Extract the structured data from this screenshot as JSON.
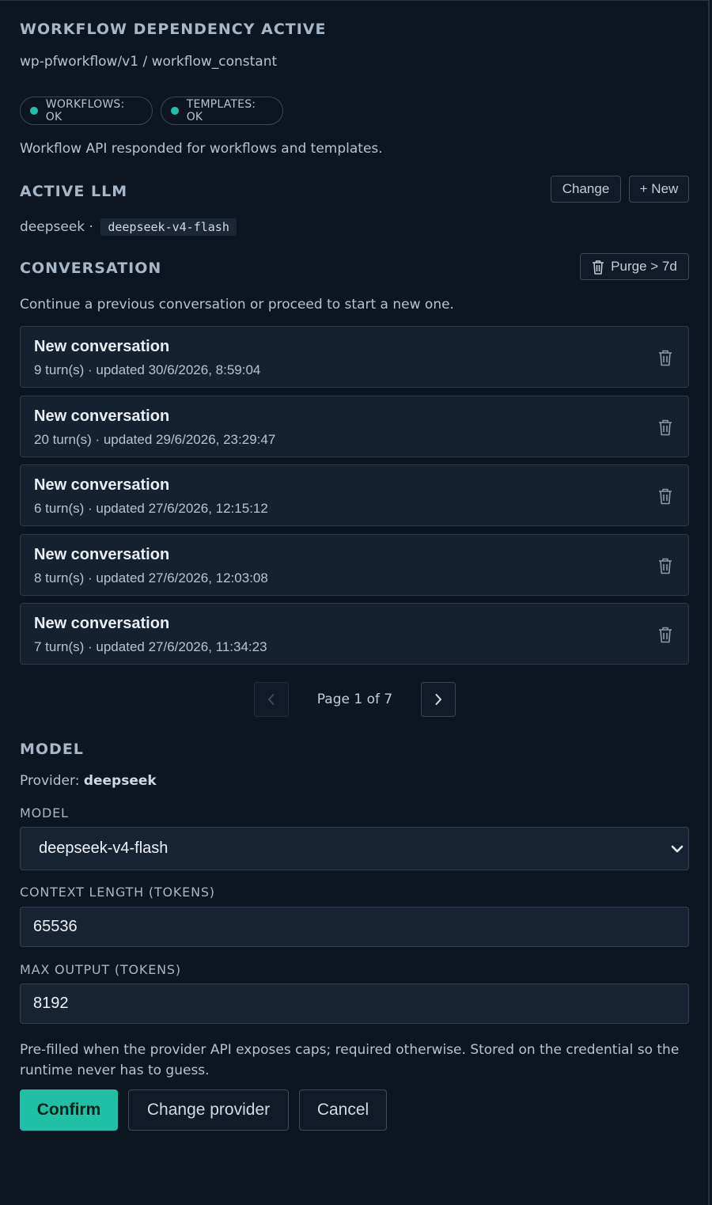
{
  "dependency": {
    "title": "WORKFLOW DEPENDENCY ACTIVE",
    "path": "wp-pfworkflow/v1 / workflow_constant",
    "status_pills": [
      {
        "label": "WORKFLOWS: OK",
        "color": "#1fc0a6"
      },
      {
        "label": "TEMPLATES: OK",
        "color": "#1fc0a6"
      }
    ],
    "message": "Workflow API responded for workflows and templates."
  },
  "active_llm": {
    "title": "ACTIVE LLM",
    "change_label": "Change",
    "new_label": "+ New",
    "provider": "deepseek",
    "separator": "·",
    "model": "deepseek-v4-flash"
  },
  "conversation": {
    "title": "CONVERSATION",
    "purge_label": "Purge > 7d",
    "hint": "Continue a previous conversation or proceed to start a new one.",
    "items": [
      {
        "title": "New conversation",
        "meta": "9 turn(s) · updated 30/6/2026, 8:59:04"
      },
      {
        "title": "New conversation",
        "meta": "20 turn(s) · updated 29/6/2026, 23:29:47"
      },
      {
        "title": "New conversation",
        "meta": "6 turn(s) · updated 27/6/2026, 12:15:12"
      },
      {
        "title": "New conversation",
        "meta": "8 turn(s) · updated 27/6/2026, 12:03:08"
      },
      {
        "title": "New conversation",
        "meta": "7 turn(s) · updated 27/6/2026, 11:34:23"
      }
    ],
    "pagination": {
      "label": "Page 1 of 7",
      "current": 1,
      "total": 7
    }
  },
  "model": {
    "title": "MODEL",
    "provider_prefix": "Provider:",
    "provider": "deepseek",
    "model_label": "MODEL",
    "model_value": "deepseek-v4-flash",
    "context_label": "CONTEXT LENGTH (TOKENS)",
    "context_value": "65536",
    "max_output_label": "MAX OUTPUT (TOKENS)",
    "max_output_value": "8192",
    "help_line1": "Pre-filled when the provider API exposes caps; required otherwise. Stored on the credential so the",
    "help_line2": "runtime never has to guess."
  },
  "actions": {
    "confirm": "Confirm",
    "change_provider": "Change provider",
    "cancel": "Cancel"
  },
  "colors": {
    "accent": "#1fc0a6",
    "background": "#0d1520",
    "card": "#162130"
  }
}
